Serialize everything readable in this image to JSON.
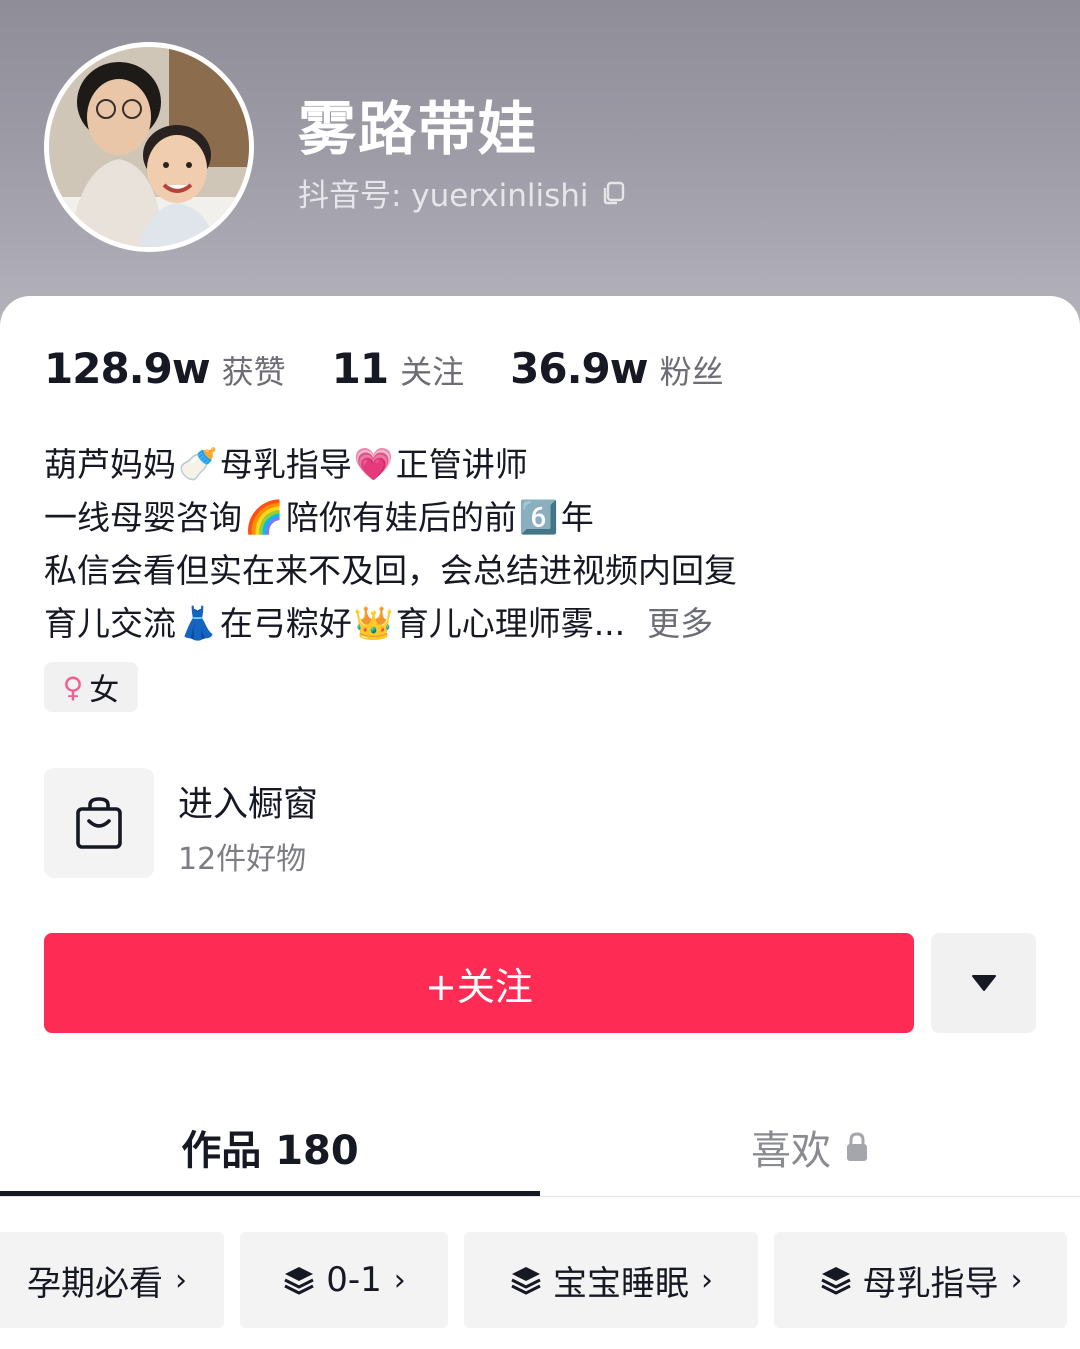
{
  "profile": {
    "nickname": "雾路带娃",
    "account_label": "抖音号: yuerxinlishi"
  },
  "stats": [
    {
      "value": "128.9w",
      "label": "获赞"
    },
    {
      "value": "11",
      "label": "关注"
    },
    {
      "value": "36.9w",
      "label": "粉丝"
    }
  ],
  "bio": {
    "line1_a": "葫芦妈妈",
    "line1_emoji1": "🍼",
    "line1_b": "母乳指导",
    "line1_emoji2": "💗",
    "line1_c": "正管讲师",
    "line2_a": "一线母婴咨询",
    "line2_emoji1": "🌈",
    "line2_b": "陪你有娃后的前",
    "line2_emoji2": "6️⃣",
    "line2_c": "年",
    "line3": "私信会看但实在来不及回，会总结进视频内回复",
    "line4_a": "育儿交流",
    "line4_emoji1": "👗",
    "line4_b": "在弓粽好",
    "line4_emoji2": "👑",
    "line4_c": "育儿心理师雾...",
    "more_label": "更多"
  },
  "gender_tag": {
    "symbol": "♀",
    "label": "女"
  },
  "shop": {
    "title": "进入橱窗",
    "subtitle": "12件好物"
  },
  "actions": {
    "follow_label": "+关注"
  },
  "tabs": {
    "works_label": "作品 180",
    "likes_label": "喜欢"
  },
  "collections": [
    {
      "label": "孕期必看"
    },
    {
      "label": "0-1"
    },
    {
      "label": "宝宝睡眠"
    },
    {
      "label": "母乳指导"
    }
  ],
  "colors": {
    "accent": "#fe2c55",
    "gender": "#f25e92",
    "text": "#161823",
    "secondary": "#6d6e75"
  },
  "icons": [
    "copy-icon",
    "shopping-bag-icon",
    "dropdown-triangle-icon",
    "lock-icon",
    "layers-icon",
    "chevron-right-icon"
  ]
}
